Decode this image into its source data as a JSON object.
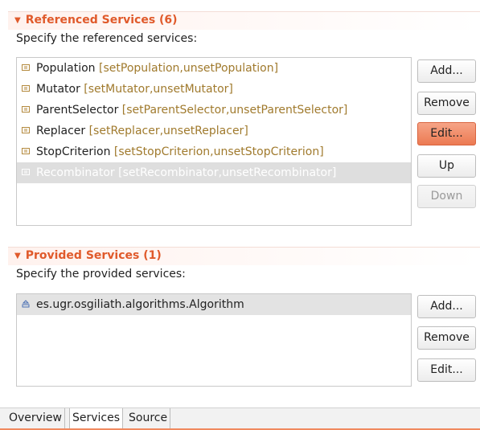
{
  "referenced": {
    "title": "Referenced Services (6)",
    "description": "Specify the referenced services:",
    "items": [
      {
        "name": "Population",
        "methods": "[setPopulation,unsetPopulation]"
      },
      {
        "name": "Mutator",
        "methods": "[setMutator,unsetMutator]"
      },
      {
        "name": "ParentSelector",
        "methods": "[setParentSelector,unsetParentSelector]"
      },
      {
        "name": "Replacer",
        "methods": "[setReplacer,unsetReplacer]"
      },
      {
        "name": "StopCriterion",
        "methods": "[setStopCriterion,unsetStopCriterion]"
      },
      {
        "name": "Recombinator",
        "methods": "[setRecombinator,unsetRecombinator]",
        "selected": true
      }
    ],
    "buttons": {
      "add": "Add...",
      "remove": "Remove",
      "edit": "Edit...",
      "up": "Up",
      "down": "Down"
    }
  },
  "provided": {
    "title": "Provided Services (1)",
    "description": "Specify the provided services:",
    "items": [
      {
        "name": "es.ugr.osgiliath.algorithms.Algorithm"
      }
    ],
    "buttons": {
      "add": "Add...",
      "remove": "Remove",
      "edit": "Edit..."
    }
  },
  "tabs": [
    "Overview",
    "Services",
    "Source"
  ],
  "active_tab": "Services",
  "colors": {
    "section_title": "#e05a2b",
    "method_text": "#a07a2d",
    "active_button": "#ec7a52",
    "tab_underline": "#f0895f"
  },
  "icons": {
    "referenced_item": "referenced-service-icon",
    "provided_item": "provided-service-icon",
    "section_toggle": "expand-arrow-icon"
  }
}
